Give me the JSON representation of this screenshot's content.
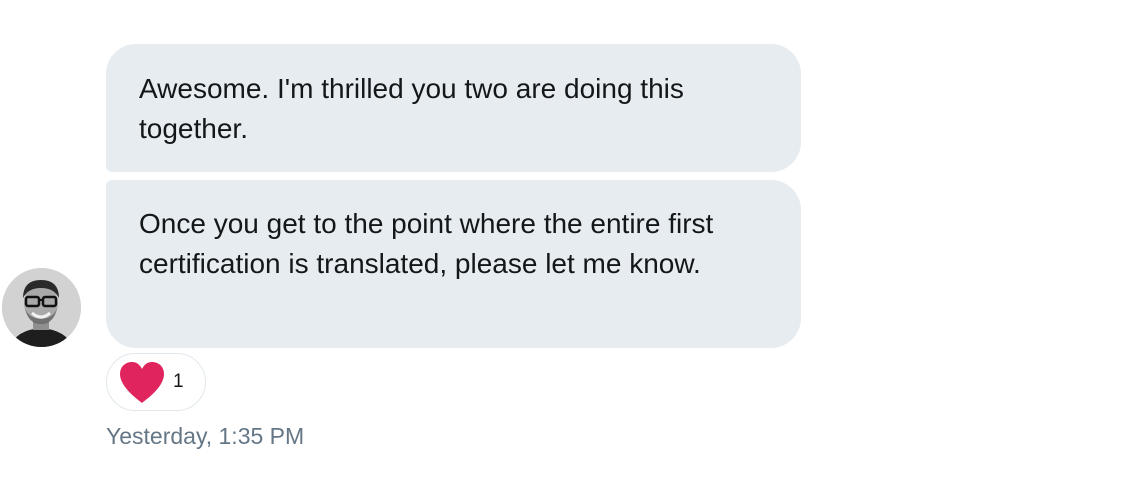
{
  "conversation": {
    "messages": [
      {
        "text": "Awesome. I'm thrilled you two are doing this together."
      },
      {
        "text": "Once you get to the point where the entire first certification is translated, please let me know."
      }
    ],
    "reaction": {
      "icon": "heart-icon",
      "count": "1",
      "color": "#e0245e"
    },
    "timestamp": "Yesterday, 1:35 PM"
  },
  "colors": {
    "bubble_background": "#e6ecf0",
    "timestamp_text": "#657786",
    "heart": "#e0245e"
  }
}
